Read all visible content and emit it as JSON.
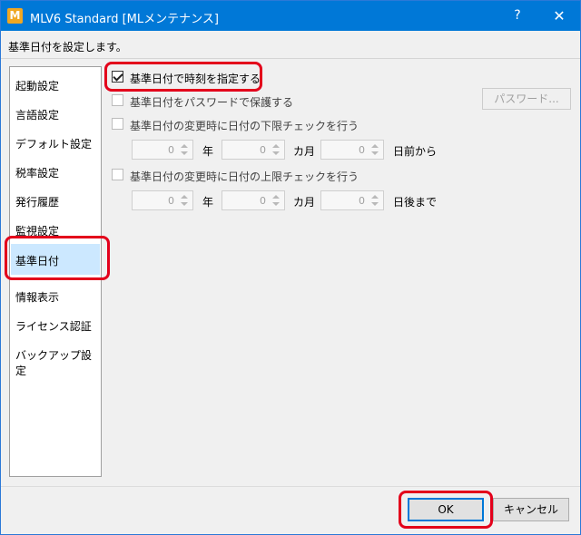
{
  "window": {
    "title": "MLV6 Standard [MLメンテナンス]",
    "icon_letter": "M",
    "help_glyph": "?",
    "close_glyph": "✕",
    "accent_color": "#0078d7"
  },
  "description": "基準日付を設定します。",
  "sidebar": {
    "items": [
      {
        "label": "起動設定"
      },
      {
        "label": "言語設定"
      },
      {
        "label": "デフォルト設定"
      },
      {
        "label": "税率設定"
      },
      {
        "label": "発行履歴"
      },
      {
        "label": "監視設定"
      },
      {
        "label": "基準日付",
        "selected": true
      },
      {
        "label": "情報表示"
      },
      {
        "label": "ライセンス認証"
      },
      {
        "label": "バックアップ設定"
      }
    ]
  },
  "main": {
    "specify_time": {
      "label": "基準日付で時刻を指定する",
      "checked": true
    },
    "password_protect": {
      "label": "基準日付をパスワードで保護する",
      "checked": false
    },
    "password_button": "パスワード...",
    "lower_limit": {
      "label": "基準日付の変更時に日付の下限チェックを行う",
      "checked": false,
      "year_value": "0",
      "year_unit": "年",
      "month_value": "0",
      "month_unit": "カ月",
      "day_value": "0",
      "day_unit": "日前から"
    },
    "upper_limit": {
      "label": "基準日付の変更時に日付の上限チェックを行う",
      "checked": false,
      "year_value": "0",
      "year_unit": "年",
      "month_value": "0",
      "month_unit": "カ月",
      "day_value": "0",
      "day_unit": "日後まで"
    }
  },
  "buttons": {
    "ok": "OK",
    "cancel": "キャンセル"
  },
  "highlight_color": "#e3001b"
}
